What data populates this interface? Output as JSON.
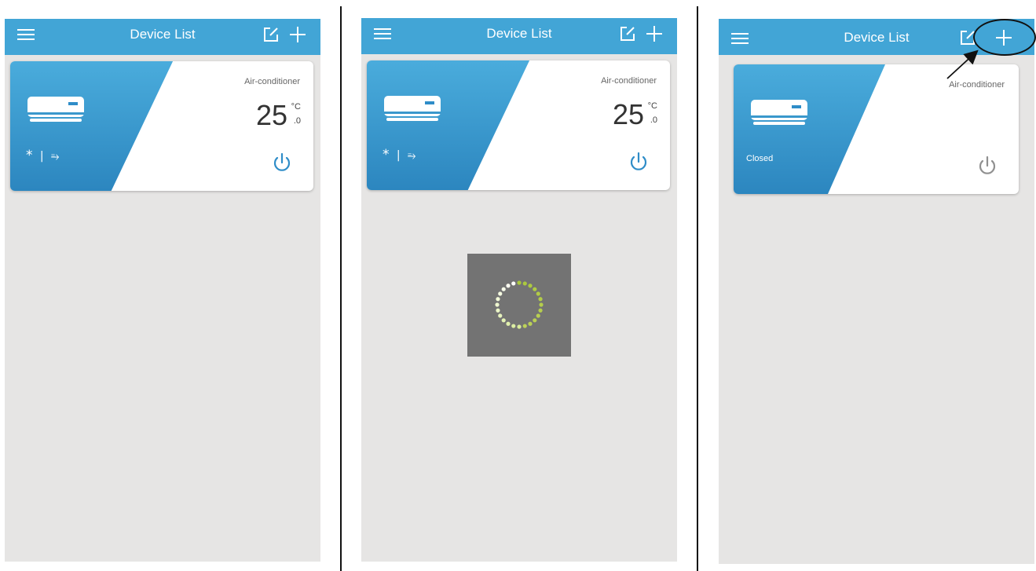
{
  "colors": {
    "header": "#42a5d6",
    "card_accent_top": "#4aacdc",
    "card_accent_bottom": "#2c86bf",
    "power_on": "#2f8dc8",
    "power_off": "#909090",
    "background": "#e6e5e4",
    "loader_box": "#737373"
  },
  "screens": [
    {
      "title": "Device List",
      "device": {
        "type": "Air-conditioner",
        "temp": "25",
        "temp_unit": "°C",
        "temp_decimal": ".0",
        "mode_cool": "*",
        "mode_sep": "|",
        "mode_fan": "⥱"
      }
    },
    {
      "title": "Device List",
      "device": {
        "type": "Air-conditioner",
        "temp": "25",
        "temp_unit": "°C",
        "temp_decimal": ".0",
        "mode_cool": "*",
        "mode_sep": "|",
        "mode_fan": "⥱"
      },
      "loading": true
    },
    {
      "title": "Device List",
      "device": {
        "type": "Air-conditioner",
        "status": "Closed"
      }
    }
  ],
  "icons": {
    "menu": "hamburger-menu-icon",
    "edit": "edit-icon",
    "add": "plus-icon",
    "device": "air-conditioner-icon",
    "power": "power-icon",
    "loading": "loading-spinner-icon"
  }
}
